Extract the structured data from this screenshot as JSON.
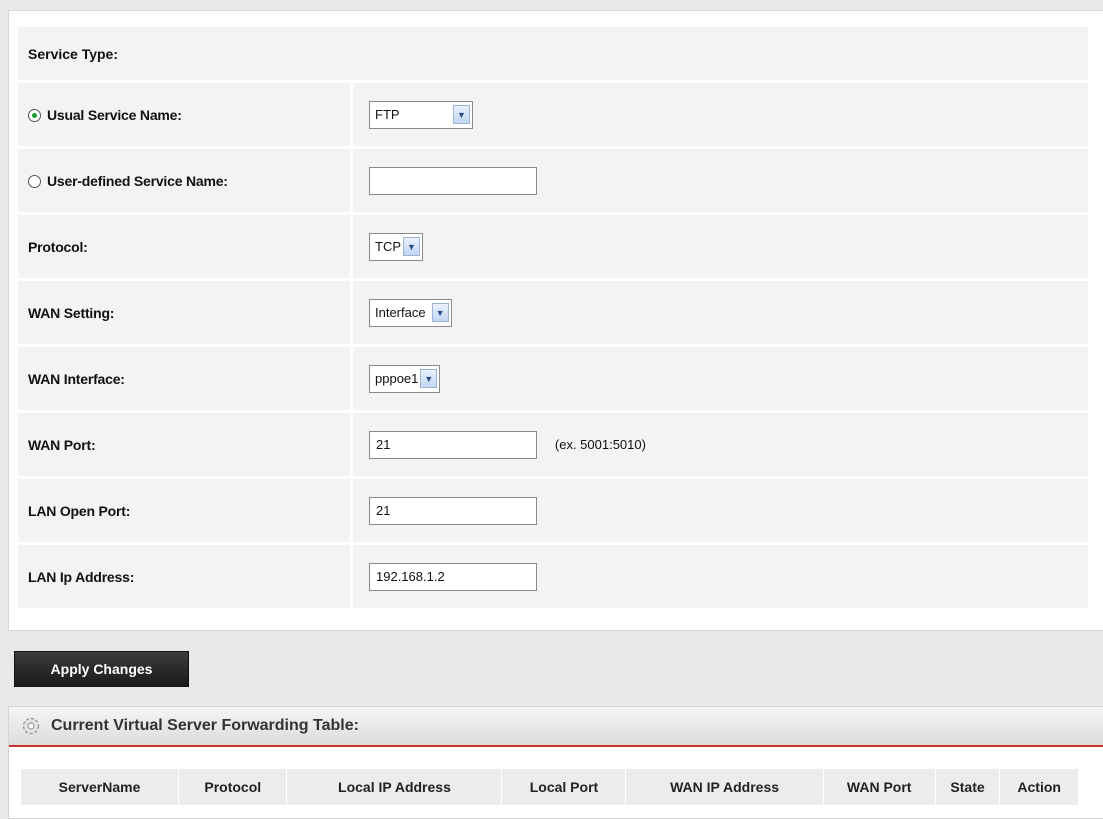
{
  "form": {
    "service_type_label": "Service Type:",
    "usual_service_label": "Usual Service Name:",
    "usual_service_value": "FTP",
    "user_defined_label": "User-defined Service Name:",
    "user_defined_value": "",
    "protocol_label": "Protocol:",
    "protocol_value": "TCP",
    "wan_setting_label": "WAN Setting:",
    "wan_setting_value": "Interface",
    "wan_interface_label": "WAN Interface:",
    "wan_interface_value": "pppoe1",
    "wan_port_label": "WAN Port:",
    "wan_port_value": "21",
    "wan_port_hint": "(ex. 5001:5010)",
    "lan_open_port_label": "LAN Open Port:",
    "lan_open_port_value": "21",
    "lan_ip_label": "LAN Ip Address:",
    "lan_ip_value": "192.168.1.2",
    "usual_service_selected": true
  },
  "actions": {
    "apply_label": "Apply Changes"
  },
  "forwarding_table": {
    "title": "Current Virtual Server Forwarding Table:",
    "columns": [
      "ServerName",
      "Protocol",
      "Local IP Address",
      "Local Port",
      "WAN IP Address",
      "WAN Port",
      "State",
      "Action"
    ]
  },
  "colors": {
    "accent_red": "#c9302c",
    "radio_green": "#1c9a2a",
    "button_dark": "#1b1b1b"
  }
}
